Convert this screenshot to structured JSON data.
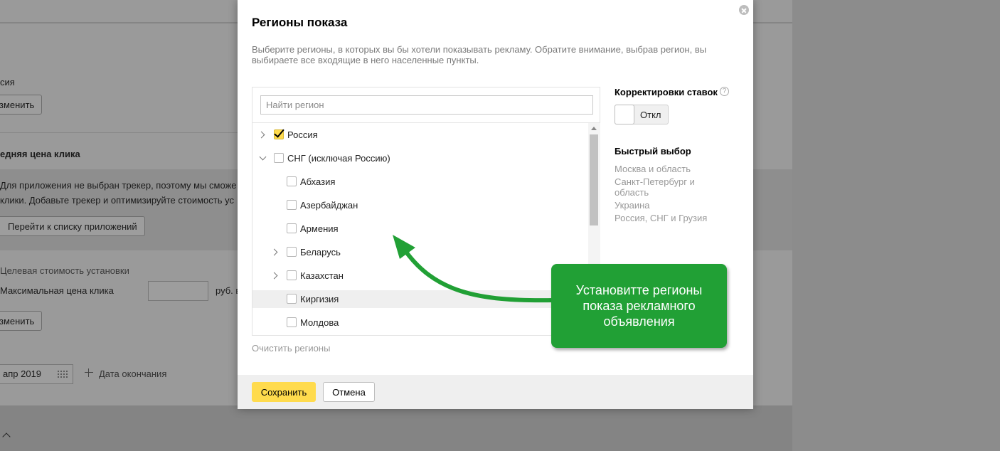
{
  "background": {
    "region_value": "сия",
    "change_button": "зменить",
    "avg_click_heading": "едняя цена клика",
    "tracker_line1": "Для приложения не выбран трекер, поэтому мы сможе",
    "tracker_line2": "клики. Добавьте трекер и оптимизируйте стоимость ус",
    "go_to_apps_button": "Перейти к списку приложений",
    "target_install_cost": "Целевая стоимость установки",
    "max_click_price": "Максимальная цена клика",
    "rub_unit": "руб. в",
    "change_button_2": "зменить",
    "start_date": "апр 2019",
    "end_date_link": "Дата окончания"
  },
  "modal": {
    "title": "Регионы показа",
    "description": "Выберите регионы, в которых вы бы хотели показывать рекламу. Обратите внимание, выбрав регион, вы выбираете все входящие в него населенные пункты.",
    "search_placeholder": "Найти регион",
    "regions": [
      {
        "label": "Россия",
        "checked": true,
        "expander": "collapsed",
        "level": 0
      },
      {
        "label": "СНГ (исключая Россию)",
        "checked": false,
        "expander": "expanded",
        "level": 0
      },
      {
        "label": "Абхазия",
        "checked": false,
        "expander": "none",
        "level": 1
      },
      {
        "label": "Азербайджан",
        "checked": false,
        "expander": "none",
        "level": 1
      },
      {
        "label": "Армения",
        "checked": false,
        "expander": "none",
        "level": 1
      },
      {
        "label": "Беларусь",
        "checked": false,
        "expander": "collapsed",
        "level": 1
      },
      {
        "label": "Казахстан",
        "checked": false,
        "expander": "collapsed",
        "level": 1
      },
      {
        "label": "Киргизия",
        "checked": false,
        "expander": "none",
        "level": 1,
        "highlighted": true
      },
      {
        "label": "Молдова",
        "checked": false,
        "expander": "none",
        "level": 1
      }
    ],
    "clear_regions": "Очистить регионы",
    "bid_adjustments_title": "Корректировки ставок",
    "bid_help": "?",
    "bid_toggle_state": "Откл",
    "quick_select_title": "Быстрый выбор",
    "quick_select": [
      "Москва и область",
      "Санкт-Петербург и область",
      "Украина",
      "Россия, СНГ и Грузия"
    ],
    "save_button": "Сохранить",
    "cancel_button": "Отмена"
  },
  "annotation": {
    "text": "Установитте регионы показа рекламного объявления",
    "color": "#21a035"
  },
  "colors": {
    "accent_yellow": "#ffdb4d",
    "muted_text": "#999999"
  }
}
